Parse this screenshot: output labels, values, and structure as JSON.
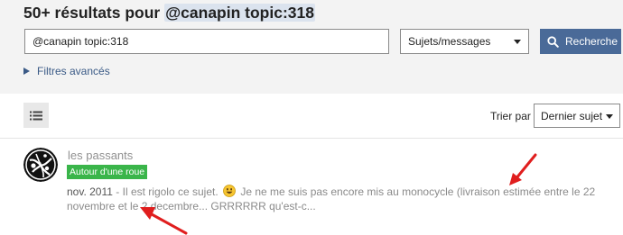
{
  "header": {
    "title_prefix": "50+ résultats pour ",
    "title_query": "@canapin topic:318"
  },
  "search": {
    "value": "@canapin topic:318",
    "scope_selected": "Sujets/messages",
    "button_label": "Recherche",
    "advanced_label": "Filtres avancés"
  },
  "sort": {
    "label": "Trier par",
    "selected": "Dernier sujet"
  },
  "result": {
    "author": "les passants",
    "category": "Autour d'une roue",
    "date": "nov. 2011",
    "separator": " - ",
    "text_before_emoji": "Il est rigolo ce sujet. ",
    "text_after_emoji": " Je ne me suis pas encore mis au monocycle (livraison estimée entre le 22 novembre et le 2 decembre... GRRRRRR qu'est-c..."
  },
  "colors": {
    "primary_button": "#4a6a98",
    "category_badge": "#3ab54a",
    "annotation_arrow": "#e01e1e"
  },
  "icons": {
    "search_button": "search-icon",
    "view_toggle": "list-view-icon",
    "emoji": "smiley-emoji-icon",
    "annotation": "red-arrow-annotation"
  }
}
